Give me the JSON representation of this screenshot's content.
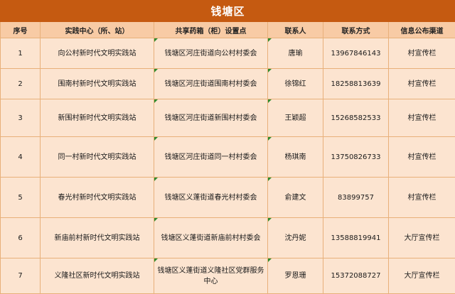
{
  "title": "钱塘区",
  "columns": [
    "序号",
    "实践中心（所、站）",
    "共享药箱（柜）设置点",
    "联系人",
    "联系方式",
    "信息公布渠道"
  ],
  "rows": [
    {
      "no": "1",
      "center": "向公村新时代文明实践站",
      "location": "钱塘区河庄街道向公村村委会",
      "contact": "唐瑜",
      "phone": "13967846143",
      "channel": "村宣传栏"
    },
    {
      "no": "2",
      "center": "围南村新时代文明实践站",
      "location": "钱塘区河庄街道围南村村委会",
      "contact": "徐锦红",
      "phone": "18258813639",
      "channel": "村宣传栏"
    },
    {
      "no": "3",
      "center": "新围村新时代文明实践站",
      "location": "钱塘区河庄街道新围村村委会",
      "contact": "王颖超",
      "phone": "15268582533",
      "channel": "村宣传栏"
    },
    {
      "no": "4",
      "center": "同一村新时代文明实践站",
      "location": "钱塘区河庄街道同一村村委会",
      "contact": "杨琪南",
      "phone": "13750826733",
      "channel": "村宣传栏"
    },
    {
      "no": "5",
      "center": "春光村新时代文明实践站",
      "location": "钱塘区义蓬街道春光村村委会",
      "contact": "俞建文",
      "phone": "83899757",
      "channel": "村宣传栏"
    },
    {
      "no": "6",
      "center": "新庙前村新时代文明实践站",
      "location": "钱塘区义蓬街道新庙前村村委会",
      "contact": "沈丹妮",
      "phone": "13588819941",
      "channel": "大厅宣传栏"
    },
    {
      "no": "7",
      "center": "义隆社区新时代文明实践站",
      "location": "钱塘区义蓬街道义隆社区党群服务中心",
      "contact": "罗恩珊",
      "phone": "15372088727",
      "channel": "大厅宣传栏"
    }
  ]
}
